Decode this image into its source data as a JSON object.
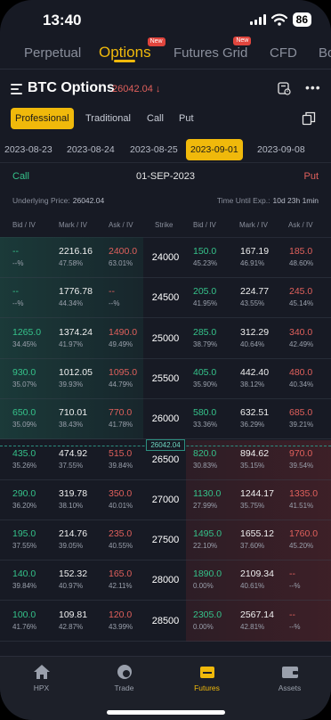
{
  "status_bar": {
    "time": "13:40",
    "battery": "86"
  },
  "top_tabs": [
    {
      "label": "Perpetual",
      "badge": "",
      "active": false
    },
    {
      "label": "Options",
      "badge": "New",
      "active": true
    },
    {
      "label": "Futures Grid",
      "badge": "New",
      "active": false
    },
    {
      "label": "CFD",
      "badge": "",
      "active": false
    },
    {
      "label": "Bo",
      "badge": "",
      "active": false
    }
  ],
  "header": {
    "title": "BTC Options",
    "price": "26042.04 ↓"
  },
  "modes": [
    "Professional",
    "Traditional",
    "Call",
    "Put"
  ],
  "active_mode": "Professional",
  "dates": [
    "2023-08-23",
    "2023-08-24",
    "2023-08-25",
    "2023-09-01",
    "2023-09-08"
  ],
  "active_date": "2023-09-01",
  "expiry_bar": {
    "call": "Call",
    "date": "01-SEP-2023",
    "put": "Put"
  },
  "info": {
    "underlying_label": "Underlying Price:",
    "underlying_value": "26042.04",
    "expiry_label": "Time Until Exp.:",
    "expiry_value": "10d 23h 1min"
  },
  "columns": {
    "call_bid": "Bid / IV",
    "call_mark": "Mark / IV",
    "call_ask": "Ask / IV",
    "strike": "Strike",
    "put_bid": "Bid / IV",
    "put_mark": "Mark / IV",
    "put_ask": "Ask / IV"
  },
  "price_marker": "26042.04",
  "rows": [
    {
      "strike": "24000",
      "call": {
        "bid": "--",
        "bid_iv": "--%",
        "mark": "2216.16",
        "mark_iv": "47.58%",
        "ask": "2400.0",
        "ask_iv": "63.01%"
      },
      "put": {
        "bid": "150.0",
        "bid_iv": "45.23%",
        "mark": "167.19",
        "mark_iv": "46.91%",
        "ask": "185.0",
        "ask_iv": "48.60%"
      }
    },
    {
      "strike": "24500",
      "call": {
        "bid": "--",
        "bid_iv": "--%",
        "mark": "1776.78",
        "mark_iv": "44.34%",
        "ask": "--",
        "ask_iv": "--%"
      },
      "put": {
        "bid": "205.0",
        "bid_iv": "41.95%",
        "mark": "224.77",
        "mark_iv": "43.55%",
        "ask": "245.0",
        "ask_iv": "45.14%"
      }
    },
    {
      "strike": "25000",
      "call": {
        "bid": "1265.0",
        "bid_iv": "34.45%",
        "mark": "1374.24",
        "mark_iv": "41.97%",
        "ask": "1490.0",
        "ask_iv": "49.49%"
      },
      "put": {
        "bid": "285.0",
        "bid_iv": "38.79%",
        "mark": "312.29",
        "mark_iv": "40.64%",
        "ask": "340.0",
        "ask_iv": "42.49%"
      }
    },
    {
      "strike": "25500",
      "call": {
        "bid": "930.0",
        "bid_iv": "35.07%",
        "mark": "1012.05",
        "mark_iv": "39.93%",
        "ask": "1095.0",
        "ask_iv": "44.79%"
      },
      "put": {
        "bid": "405.0",
        "bid_iv": "35.90%",
        "mark": "442.40",
        "mark_iv": "38.12%",
        "ask": "480.0",
        "ask_iv": "40.34%"
      }
    },
    {
      "strike": "26000",
      "call": {
        "bid": "650.0",
        "bid_iv": "35.09%",
        "mark": "710.01",
        "mark_iv": "38.43%",
        "ask": "770.0",
        "ask_iv": "41.78%"
      },
      "put": {
        "bid": "580.0",
        "bid_iv": "33.36%",
        "mark": "632.51",
        "mark_iv": "36.29%",
        "ask": "685.0",
        "ask_iv": "39.21%"
      }
    },
    {
      "strike": "26500",
      "call": {
        "bid": "435.0",
        "bid_iv": "35.26%",
        "mark": "474.92",
        "mark_iv": "37.55%",
        "ask": "515.0",
        "ask_iv": "39.84%"
      },
      "put": {
        "bid": "820.0",
        "bid_iv": "30.83%",
        "mark": "894.62",
        "mark_iv": "35.15%",
        "ask": "970.0",
        "ask_iv": "39.54%"
      }
    },
    {
      "strike": "27000",
      "call": {
        "bid": "290.0",
        "bid_iv": "36.20%",
        "mark": "319.78",
        "mark_iv": "38.10%",
        "ask": "350.0",
        "ask_iv": "40.01%"
      },
      "put": {
        "bid": "1130.0",
        "bid_iv": "27.99%",
        "mark": "1244.17",
        "mark_iv": "35.75%",
        "ask": "1335.0",
        "ask_iv": "41.51%"
      }
    },
    {
      "strike": "27500",
      "call": {
        "bid": "195.0",
        "bid_iv": "37.55%",
        "mark": "214.76",
        "mark_iv": "39.05%",
        "ask": "235.0",
        "ask_iv": "40.55%"
      },
      "put": {
        "bid": "1495.0",
        "bid_iv": "22.10%",
        "mark": "1655.12",
        "mark_iv": "37.60%",
        "ask": "1760.0",
        "ask_iv": "45.20%"
      }
    },
    {
      "strike": "28000",
      "call": {
        "bid": "140.0",
        "bid_iv": "39.84%",
        "mark": "152.32",
        "mark_iv": "40.97%",
        "ask": "165.0",
        "ask_iv": "42.11%"
      },
      "put": {
        "bid": "1890.0",
        "bid_iv": "0.00%",
        "mark": "2109.34",
        "mark_iv": "40.61%",
        "ask": "--",
        "ask_iv": "--%"
      }
    },
    {
      "strike": "28500",
      "call": {
        "bid": "100.0",
        "bid_iv": "41.76%",
        "mark": "109.81",
        "mark_iv": "42.87%",
        "ask": "120.0",
        "ask_iv": "43.99%"
      },
      "put": {
        "bid": "2305.0",
        "bid_iv": "0.00%",
        "mark": "2567.14",
        "mark_iv": "42.81%",
        "ask": "--",
        "ask_iv": "--%"
      }
    }
  ],
  "bottom_nav": [
    {
      "label": "HPX",
      "icon": "home-icon",
      "active": false
    },
    {
      "label": "Trade",
      "icon": "trade-icon",
      "active": false
    },
    {
      "label": "Futures",
      "icon": "futures-icon",
      "active": true
    },
    {
      "label": "Assets",
      "icon": "wallet-icon",
      "active": false
    }
  ],
  "colors": {
    "accent": "#f0b90b",
    "up": "#35c28a",
    "down": "#e0605c",
    "bg": "#171a24"
  }
}
